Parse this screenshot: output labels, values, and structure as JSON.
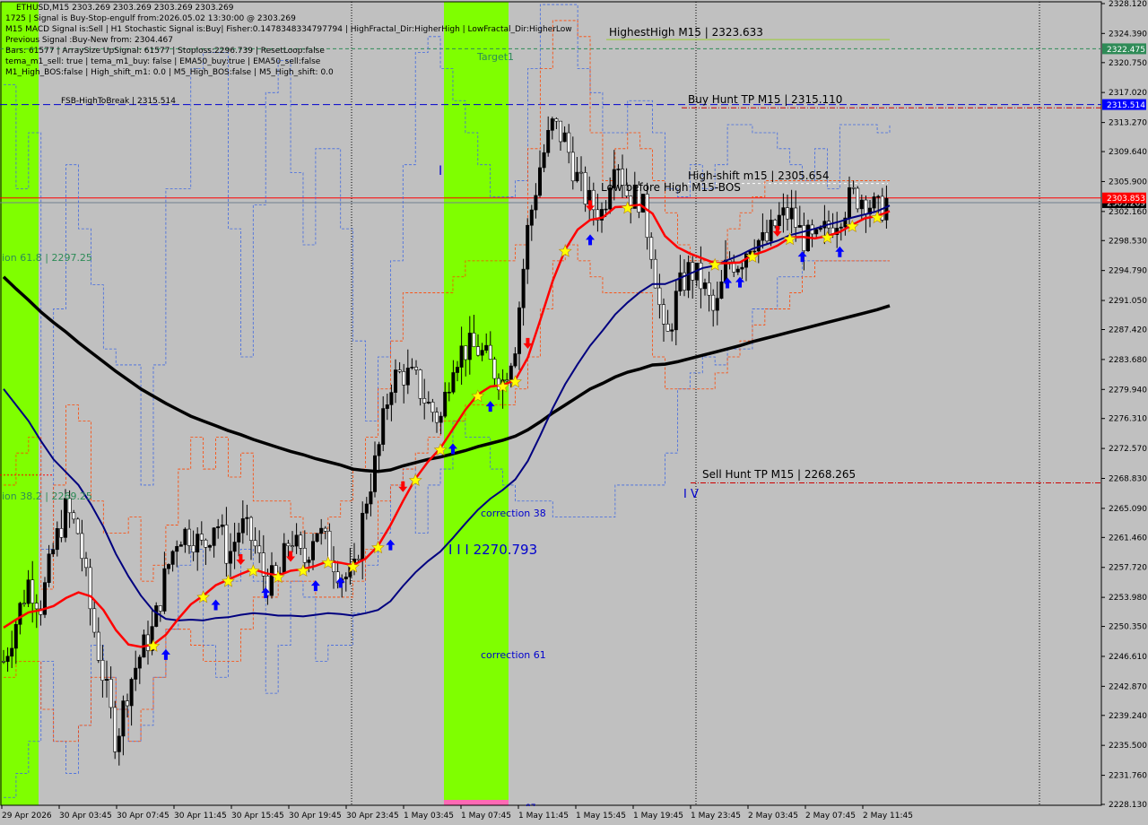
{
  "header": {
    "symbol_line": "ETHUSD,M15  2303.269 2303.269 2303.269 2303.269",
    "lines": [
      "1725 | Signal is Buy-Stop-engulf from:2026.05.02 13:30:00 @ 2303.269",
      "M15 MACD Signal is:Sell | H1 Stochastic Signal is:Buy| Fisher:0.1478348334797794 | HighFractal_Dir:HigherHigh | LowFractal_Dir:HigherLow",
      "Previous Signal :Buy-New from: 2304.467",
      "Bars: 61577 | ArraySize UpSignal: 61577 | Stoploss:2296.739 | ResetLoop:false",
      "tema_m1_sell: true | tema_m1_buy: false | EMA50_buy:true | EMA50_sell:false",
      "M1_High_BOS:false | High_shift_m1: 0.0 | M5_High_BOS:false | M5_High_shift: 0.0"
    ]
  },
  "colors": {
    "background": "#c0c0c0",
    "bull_candle": "#000000",
    "ema_red": "#ff0000",
    "ema_navy": "#00007f",
    "ema_black": "#000000",
    "highlight_green": "#7fff00",
    "price_tag_green": "#2e8b57",
    "price_tag_blue": "#0000ff",
    "price_tag_red": "#ff0000",
    "price_tag_black": "#000000",
    "band_blue": "#4169e1",
    "band_orange": "#ff4500"
  },
  "annotations": {
    "target": "Target1",
    "highest_high": "HighestHigh   M15 | 2323.633",
    "fsb": "FSB-HighToBreak | 2315.514",
    "buy_hunt": "Buy Hunt TP M15 | 2315.110",
    "high_shift": "High-shift m15 | 2305.654",
    "low_before_high": "Low before High   M15-BOS",
    "fib618": "ion 61.8 | 2297.25",
    "fib382": "ion 38.2 | 2269.25",
    "correction38": "correction 38",
    "correction61": "correction 61",
    "level_2270": "I I I 2270.793",
    "sell_hunt": "Sell Hunt TP M15 | 2268.265",
    "roman_iv": "I V",
    "roman_i": "I",
    "bottom_label": "87"
  },
  "price_tags": [
    {
      "label": "2322.475",
      "price": 2322.475,
      "color": "price_tag_green"
    },
    {
      "label": "2315.514",
      "price": 2315.514,
      "color": "price_tag_blue"
    },
    {
      "label": "2303.269",
      "price": 2303.269,
      "color": "price_tag_black"
    },
    {
      "label": "2303.853",
      "price": 2303.853,
      "color": "price_tag_red"
    }
  ],
  "chart_data": {
    "type": "candlestick",
    "symbol": "ETHUSD",
    "timeframe": "M15",
    "ylim": [
      2228.13,
      2328.12
    ],
    "y_ticks": [
      "2328.120",
      "2324.390",
      "2320.750",
      "2317.020",
      "2313.270",
      "2309.640",
      "2305.900",
      "2302.160",
      "2298.530",
      "2294.790",
      "2291.050",
      "2287.420",
      "2283.680",
      "2279.940",
      "2276.310",
      "2272.570",
      "2268.830",
      "2265.090",
      "2261.460",
      "2257.720",
      "2253.980",
      "2250.350",
      "2246.610",
      "2242.870",
      "2239.240",
      "2235.500",
      "2231.760",
      "2228.130"
    ],
    "x_ticks": [
      "29 Apr 2026",
      "30 Apr 03:45",
      "30 Apr 07:45",
      "30 Apr 11:45",
      "30 Apr 15:45",
      "30 Apr 19:45",
      "30 Apr 23:45",
      "1 May 03:45",
      "1 May 07:45",
      "1 May 11:45",
      "1 May 15:45",
      "1 May 19:45",
      "1 May 23:45",
      "2 May 03:45",
      "2 May 07:45",
      "2 May 11:45"
    ],
    "close_path": [
      2246,
      2251,
      2256,
      2253,
      2260,
      2265,
      2262,
      2252,
      2244,
      2236,
      2243,
      2247,
      2250,
      2257,
      2262,
      2262,
      2260,
      2264,
      2259,
      2263,
      2261,
      2256,
      2256,
      2262,
      2258,
      2263,
      2260,
      2257,
      2256,
      2266,
      2272,
      2281,
      2282,
      2281,
      2278,
      2276,
      2284,
      2285,
      2285,
      2283,
      2281,
      2286,
      2300,
      2308,
      2313,
      2311,
      2306,
      2303,
      2302,
      2310,
      2304,
      2304,
      2297,
      2285,
      2292,
      2295,
      2293,
      2289,
      2296,
      2296,
      2299,
      2298,
      2301,
      2302,
      2299,
      2298,
      2300,
      2302,
      2304,
      2304,
      2302,
      2304
    ],
    "series": [
      {
        "name": "Band upper (blue dashed)",
        "values": [
          2318,
          2305,
          2312,
          2260,
          2290,
          2308,
          2300,
          2293,
          2285,
          2283,
          2283,
          2268,
          2283,
          2305,
          2305,
          2320,
          2322,
          2322,
          2300,
          2284,
          2303,
          2317,
          2321,
          2307,
          2298,
          2310,
          2310,
          2300,
          2286,
          2276,
          2284,
          2296,
          2308,
          2322,
          2324,
          2320,
          2316,
          2312,
          2308,
          2304,
          2304,
          2306,
          2320,
          2328,
          2328,
          2328,
          2320,
          2317,
          2312,
          2312,
          2316,
          2316,
          2312,
          2305,
          2304,
          2308,
          2305,
          2308,
          2313,
          2313,
          2312,
          2312,
          2310,
          2308,
          2306,
          2310,
          2305,
          2313,
          2313,
          2313,
          2312,
          2313
        ]
      },
      {
        "name": "Band lower (blue dashed)",
        "values": [
          2229,
          2232,
          2236,
          2246,
          2236,
          2232,
          2238,
          2248,
          2244,
          2240,
          2236,
          2238,
          2244,
          2250,
          2258,
          2260,
          2248,
          2244,
          2256,
          2260,
          2256,
          2242,
          2248,
          2256,
          2254,
          2246,
          2248,
          2248,
          2252,
          2258,
          2262,
          2268,
          2270,
          2262,
          2268,
          2270,
          2276,
          2274,
          2274,
          2270,
          2268,
          2266,
          2266,
          2266,
          2264,
          2264,
          2264,
          2264,
          2264,
          2268,
          2268,
          2268,
          2268,
          2272,
          2280,
          2282,
          2284,
          2283,
          2285,
          2285,
          2290,
          2290,
          2294,
          2294,
          2296,
          2296,
          2296,
          2296,
          2296,
          2296,
          2296,
          2296
        ]
      },
      {
        "name": "Band upper (orange dashed)",
        "values": [
          2268,
          2272,
          2274,
          2255,
          2268,
          2278,
          2276,
          2266,
          2262,
          2262,
          2264,
          2256,
          2258,
          2263,
          2270,
          2274,
          2270,
          2274,
          2269,
          2272,
          2266,
          2266,
          2266,
          2264,
          2262,
          2262,
          2264,
          2266,
          2270,
          2274,
          2280,
          2286,
          2292,
          2292,
          2292,
          2292,
          2294,
          2296,
          2296,
          2296,
          2296,
          2298,
          2310,
          2320,
          2326,
          2326,
          2324,
          2312,
          2306,
          2310,
          2312,
          2310,
          2306,
          2302,
          2298,
          2296,
          2296,
          2296,
          2300,
          2302,
          2304,
          2306,
          2306,
          2306,
          2306,
          2306,
          2306,
          2306,
          2306,
          2306,
          2306,
          2306
        ]
      },
      {
        "name": "Band lower (orange dashed)",
        "values": [
          2244,
          2246,
          2246,
          2240,
          2236,
          2236,
          2238,
          2244,
          2244,
          2240,
          2236,
          2240,
          2244,
          2250,
          2250,
          2248,
          2246,
          2246,
          2246,
          2250,
          2254,
          2254,
          2256,
          2256,
          2256,
          2254,
          2254,
          2254,
          2256,
          2260,
          2266,
          2268,
          2270,
          2272,
          2274,
          2276,
          2276,
          2278,
          2278,
          2278,
          2278,
          2280,
          2284,
          2290,
          2296,
          2298,
          2296,
          2294,
          2292,
          2292,
          2292,
          2292,
          2284,
          2280,
          2280,
          2280,
          2280,
          2282,
          2284,
          2286,
          2288,
          2290,
          2290,
          2292,
          2294,
          2296,
          2296,
          2296,
          2296,
          2296,
          2296,
          2296
        ]
      },
      {
        "name": "Fast EMA (red)",
        "values": [
          2250.2,
          2251.2,
          2252.1,
          2252.4,
          2252.9,
          2253.9,
          2254.6,
          2254.1,
          2252.4,
          2249.9,
          2248.1,
          2247.8,
          2248.1,
          2249.3,
          2251.3,
          2253.1,
          2254.2,
          2255.5,
          2256.2,
          2256.9,
          2257.5,
          2257.0,
          2256.7,
          2257.3,
          2257.5,
          2257.9,
          2258.5,
          2258.3,
          2258.0,
          2258.8,
          2260.4,
          2263.0,
          2266.0,
          2268.8,
          2270.9,
          2272.6,
          2275.0,
          2277.4,
          2279.3,
          2280.3,
          2280.5,
          2281.1,
          2283.9,
          2288.6,
          2293.5,
          2297.4,
          2299.9,
          2301.1,
          2301.4,
          2302.7,
          2302.8,
          2303.0,
          2301.9,
          2299.1,
          2297.7,
          2296.9,
          2296.3,
          2295.7,
          2295.7,
          2295.8,
          2296.7,
          2297.2,
          2297.9,
          2298.9,
          2299.0,
          2298.8,
          2299.1,
          2299.6,
          2300.5,
          2301.3,
          2301.6,
          2302.2
        ]
      },
      {
        "name": "Mid EMA (navy)",
        "values": [
          2280.0,
          2278.0,
          2276.0,
          2273.5,
          2271.2,
          2269.6,
          2268.0,
          2265.6,
          2262.8,
          2259.4,
          2256.6,
          2254.2,
          2252.3,
          2251.3,
          2251.1,
          2251.2,
          2251.1,
          2251.4,
          2251.5,
          2251.8,
          2252.0,
          2251.9,
          2251.7,
          2251.7,
          2251.6,
          2251.8,
          2252.0,
          2251.9,
          2251.7,
          2252.0,
          2252.4,
          2253.5,
          2255.4,
          2257.1,
          2258.5,
          2259.7,
          2261.4,
          2263.2,
          2264.9,
          2266.3,
          2267.4,
          2268.7,
          2271.0,
          2274.2,
          2277.6,
          2280.6,
          2283.1,
          2285.4,
          2287.3,
          2289.3,
          2290.8,
          2292.1,
          2293.1,
          2293.1,
          2293.7,
          2294.4,
          2295.1,
          2295.4,
          2296.1,
          2296.7,
          2297.5,
          2298.0,
          2298.5,
          2299.2,
          2299.6,
          2300.0,
          2300.5,
          2300.9,
          2301.4,
          2301.8,
          2302.2,
          2302.9
        ]
      },
      {
        "name": "Slow EMA (black)",
        "values": [
          2294.0,
          2292.5,
          2291.1,
          2289.6,
          2288.3,
          2287.1,
          2285.8,
          2284.6,
          2283.4,
          2282.2,
          2281.1,
          2280.0,
          2279.1,
          2278.2,
          2277.4,
          2276.6,
          2276.0,
          2275.4,
          2274.8,
          2274.3,
          2273.7,
          2273.2,
          2272.7,
          2272.2,
          2271.8,
          2271.3,
          2270.9,
          2270.5,
          2270.0,
          2269.8,
          2269.7,
          2269.9,
          2270.4,
          2270.8,
          2271.2,
          2271.5,
          2271.9,
          2272.3,
          2272.8,
          2273.2,
          2273.6,
          2274.1,
          2274.9,
          2275.9,
          2277.0,
          2278.0,
          2279.0,
          2280.0,
          2280.7,
          2281.5,
          2282.1,
          2282.5,
          2283.0,
          2283.1,
          2283.4,
          2283.8,
          2284.2,
          2284.6,
          2285.0,
          2285.4,
          2285.9,
          2286.3,
          2286.7,
          2287.1,
          2287.5,
          2287.9,
          2288.3,
          2288.7,
          2289.1,
          2289.5,
          2289.9,
          2290.4
        ]
      }
    ]
  }
}
